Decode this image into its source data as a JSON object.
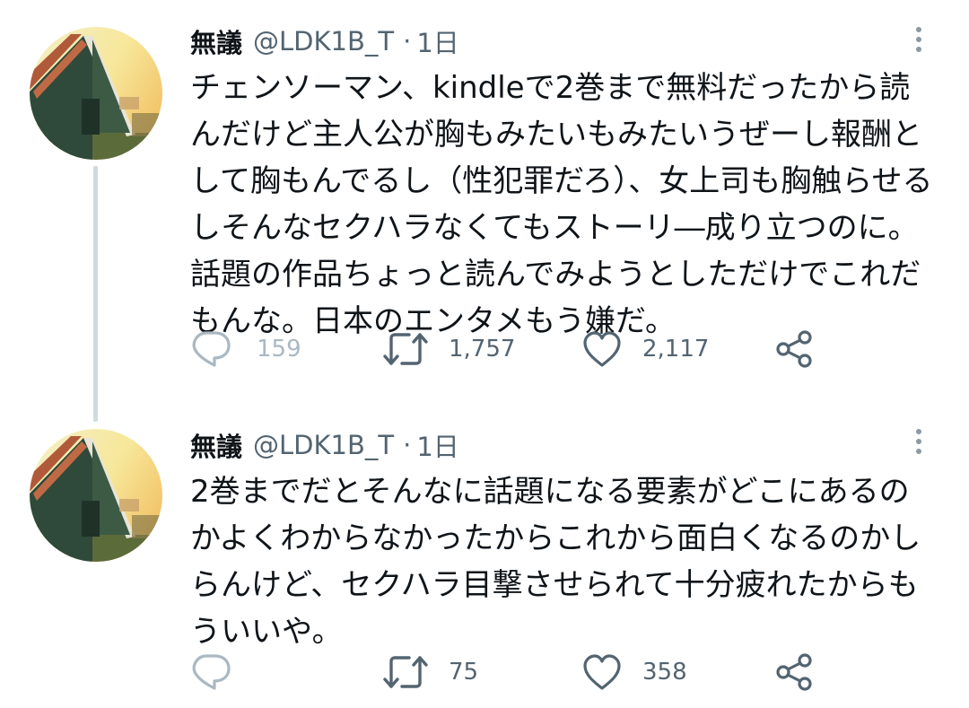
{
  "tweets": [
    {
      "user": {
        "display_name": "無議",
        "handle": "@LDK1B_T",
        "separator": "·",
        "time": "1日"
      },
      "text": "チェンソーマン、kindleで2巻まで無料だったから読んだけど主人公が胸もみたいもみたいうぜーし報酬として胸もんでるし（性犯罪だろ）、女上司も胸触らせるしそんなセクハラなくてもストーリ―成り立つのに。話題の作品ちょっと読んでみようとしただけでこれだもんな。日本のエンタメもう嫌だ。",
      "stats": {
        "replies": "159",
        "retweets": "1,757",
        "likes": "2,117"
      },
      "icons": {
        "reply": "reply-icon",
        "retweet": "retweet-icon",
        "like": "heart-icon",
        "share": "share-icon",
        "more": "more-icon"
      }
    },
    {
      "user": {
        "display_name": "無議",
        "handle": "@LDK1B_T",
        "separator": "·",
        "time": "1日"
      },
      "text": "2巻までだとそんなに話題になる要素がどこにあるのかよくわからなかったからこれから面白くなるのかしらんけど、セクハラ目撃させられて十分疲れたからもういいや。",
      "stats": {
        "replies": "",
        "retweets": "75",
        "likes": "358"
      },
      "icons": {
        "reply": "reply-icon",
        "retweet": "retweet-icon",
        "like": "heart-icon",
        "share": "share-icon",
        "more": "more-icon"
      }
    }
  ],
  "colors": {
    "text": "#0f1419",
    "secondary": "#536471",
    "thread_line": "#cfd9de",
    "muted_icon": "#aab8c2"
  }
}
